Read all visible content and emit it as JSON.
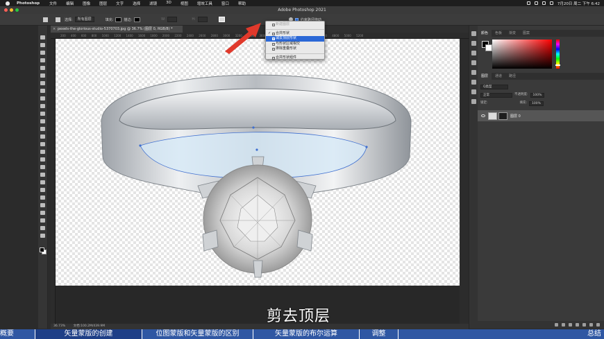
{
  "menubar": {
    "app_name": "Photoshop",
    "items": [
      "文件",
      "编辑",
      "图像",
      "图层",
      "文字",
      "选择",
      "滤镜",
      "3D",
      "视图",
      "增效工具",
      "窗口",
      "帮助"
    ],
    "clock": "7月20日 周二 下午 6:42"
  },
  "window": {
    "title": "Adobe Photoshop 2021"
  },
  "options_bar": {
    "select_label": "选择:",
    "select_value": "所有图层",
    "fill_label": "填充:",
    "stroke_label": "描边:",
    "w_label": "W:",
    "h_label": "H:",
    "align_edges_label": "约束路径拖动"
  },
  "document": {
    "tab_title": "pexels-the-glorious-studio-5370703.jpg @ 36.7% (图层 0, RGB/8) *",
    "close_glyph": "×",
    "ruler_ticks": [
      "200",
      "400",
      "600",
      "800",
      "1000",
      "1200",
      "1400",
      "1600",
      "1800",
      "2000",
      "2200",
      "2400",
      "2600",
      "2800",
      "3000",
      "3200",
      "3400",
      "3600",
      "3800",
      "4000",
      "4200",
      "4400",
      "4600",
      "4800",
      "5000",
      "5200"
    ],
    "zoom": "36.73%",
    "doc_info": "文档:100.2M/439.9M"
  },
  "path_ops_menu": {
    "items": [
      {
        "label": "新建图层",
        "checked": false,
        "disabled": true,
        "highlighted": false
      },
      {
        "label": "合并形状",
        "checked": true,
        "disabled": false,
        "highlighted": false
      },
      {
        "label": "减去顶层形状",
        "checked": false,
        "disabled": false,
        "highlighted": true
      },
      {
        "label": "与形状区域相交",
        "checked": false,
        "disabled": false,
        "highlighted": false
      },
      {
        "label": "排除重叠形状",
        "checked": false,
        "disabled": false,
        "highlighted": false
      }
    ],
    "merge_label": "合并形状组件",
    "check_glyph": "✓"
  },
  "subtitle": "剪去顶层",
  "panels": {
    "color_tabs": [
      "颜色",
      "色板",
      "渐变",
      "图案"
    ],
    "layer_tabs": [
      "图层",
      "通道",
      "路径"
    ],
    "kind_filter": "Q类型",
    "blend_mode": "正常",
    "opacity_label": "不透明度:",
    "opacity_value": "100%",
    "lock_label": "锁定:",
    "fill_label": "填充:",
    "fill_value": "100%",
    "layer_name": "图层 0"
  },
  "chapters": [
    {
      "label": "概要",
      "active": false
    },
    {
      "label": "矢量蒙版的创建",
      "active": true
    },
    {
      "label": "位图蒙版和矢量蒙版的区别",
      "active": false
    },
    {
      "label": "矢量蒙版的布尔运算",
      "active": false
    },
    {
      "label": "调整",
      "active": false
    },
    {
      "label": "总结",
      "active": false
    }
  ],
  "colors": {
    "accent": "#2a67d6",
    "chapter_bar": "#2f57a3",
    "arrow": "#e0392b",
    "path": "#3f6fd0"
  }
}
